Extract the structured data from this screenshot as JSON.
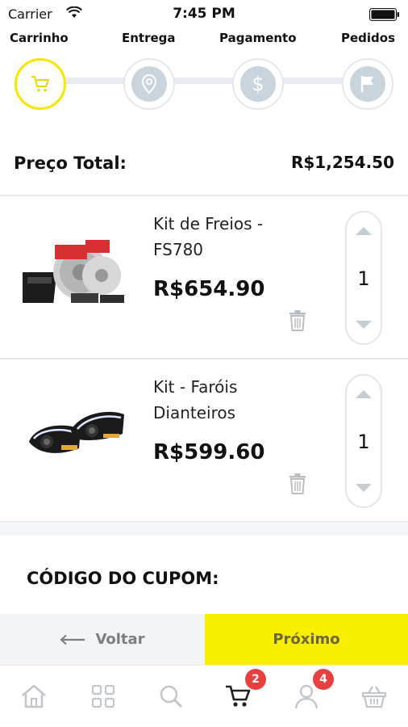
{
  "status_bar": {
    "carrier": "Carrier",
    "time": "7:45 PM"
  },
  "steps": [
    {
      "label": "Carrinho",
      "icon": "cart-icon",
      "active": true
    },
    {
      "label": "Entrega",
      "icon": "location-pin-icon",
      "active": false
    },
    {
      "label": "Pagamento",
      "icon": "dollar-icon",
      "active": false
    },
    {
      "label": "Pedidos",
      "icon": "flag-icon",
      "active": false
    }
  ],
  "summary": {
    "total_label": "Preço Total:",
    "total_value": "R$1,254.50"
  },
  "cart_items": [
    {
      "name": "Kit de Freios - FS780",
      "price": "R$654.90",
      "quantity": "1"
    },
    {
      "name": "Kit - Faróis Dianteiros",
      "price": "R$599.60",
      "quantity": "1"
    }
  ],
  "coupon": {
    "label": "CÓDIGO DO CUPOM:"
  },
  "actions": {
    "back_label": "Voltar",
    "next_label": "Próximo"
  },
  "tab_bar": {
    "items": [
      {
        "icon": "home-icon"
      },
      {
        "icon": "grid-icon"
      },
      {
        "icon": "search-icon"
      },
      {
        "icon": "cart-icon",
        "badge": "2",
        "active": true
      },
      {
        "icon": "user-icon",
        "badge": "4"
      },
      {
        "icon": "basket-icon"
      }
    ]
  },
  "colors": {
    "accent": "#f9ed00",
    "badge": "#e84040",
    "inactive_icon": "#c9d4dc"
  }
}
